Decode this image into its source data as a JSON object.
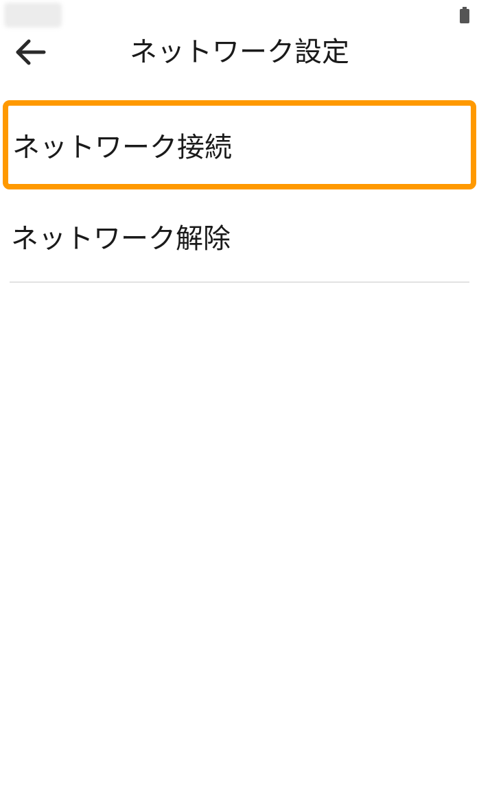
{
  "status_bar": {
    "time_blurred": true,
    "battery_icon": "battery-icon"
  },
  "app_bar": {
    "back_icon": "arrow-left-icon",
    "title": "ネットワーク設定"
  },
  "menu": {
    "items": [
      {
        "label": "ネットワーク接続",
        "highlighted": true
      },
      {
        "label": "ネットワーク解除",
        "highlighted": false
      }
    ]
  },
  "colors": {
    "highlight": "#ff9900",
    "divider": "#e2e2e2",
    "text": "#1a1a1a"
  }
}
